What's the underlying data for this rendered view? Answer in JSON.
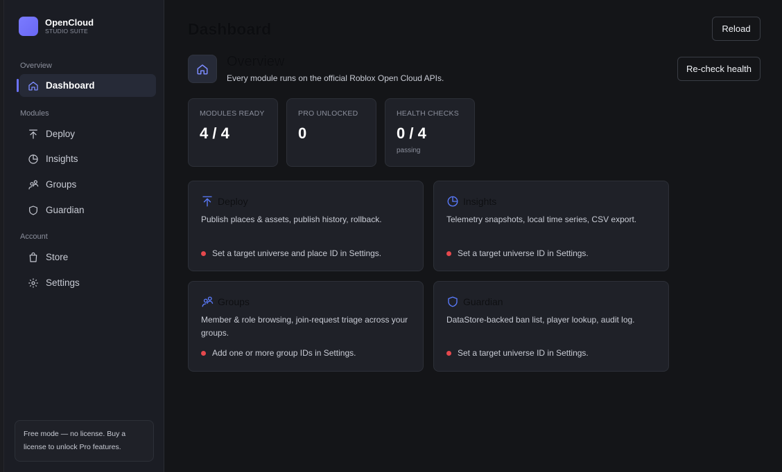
{
  "brand": {
    "name": "OpenCloud",
    "subtitle": "STUDIO SUITE"
  },
  "sidebar": {
    "sections": {
      "overview": "Overview",
      "modules": "Modules",
      "account": "Account"
    },
    "items": [
      {
        "label": "Dashboard",
        "icon": "home-icon",
        "active": true
      },
      {
        "label": "Deploy",
        "icon": "upload-icon"
      },
      {
        "label": "Insights",
        "icon": "pie-chart-icon"
      },
      {
        "label": "Groups",
        "icon": "users-icon"
      },
      {
        "label": "Guardian",
        "icon": "shield-icon"
      },
      {
        "label": "Store",
        "icon": "shopping-bag-icon"
      },
      {
        "label": "Settings",
        "icon": "gear-icon"
      }
    ],
    "license_note": "Free mode — no license. Buy a license to unlock Pro features."
  },
  "main": {
    "title": "Dashboard",
    "reload_label": "Reload",
    "recheck_label": "Re-check health",
    "overview": {
      "title": "Overview",
      "description": "Every module runs on the official Roblox Open Cloud APIs."
    },
    "stats": [
      {
        "label": "MODULES READY",
        "value": "4 / 4",
        "sub": ""
      },
      {
        "label": "PRO UNLOCKED",
        "value": "0",
        "sub": ""
      },
      {
        "label": "HEALTH CHECKS",
        "value": "0 / 4",
        "sub": "passing"
      }
    ],
    "modules": [
      {
        "title": "Deploy",
        "icon": "upload-icon",
        "description": "Publish places & assets, publish history, rollback.",
        "status": "Set a target universe and place ID in Settings."
      },
      {
        "title": "Insights",
        "icon": "pie-chart-icon",
        "description": "Telemetry snapshots, local time series, CSV export.",
        "status": "Set a target universe ID in Settings."
      },
      {
        "title": "Groups",
        "icon": "users-icon",
        "description": "Member & role browsing, join-request triage across your groups.",
        "status": "Add one or more group IDs in Settings."
      },
      {
        "title": "Guardian",
        "icon": "shield-icon",
        "description": "DataStore-backed ban list, player lookup, audit log.",
        "status": "Set a target universe ID in Settings."
      }
    ]
  },
  "colors": {
    "accent": "#6c73ff",
    "card_icon": "#5b7cff",
    "status_error": "#e5484d",
    "background": "#141518",
    "sidebar": "#1b1d24"
  }
}
